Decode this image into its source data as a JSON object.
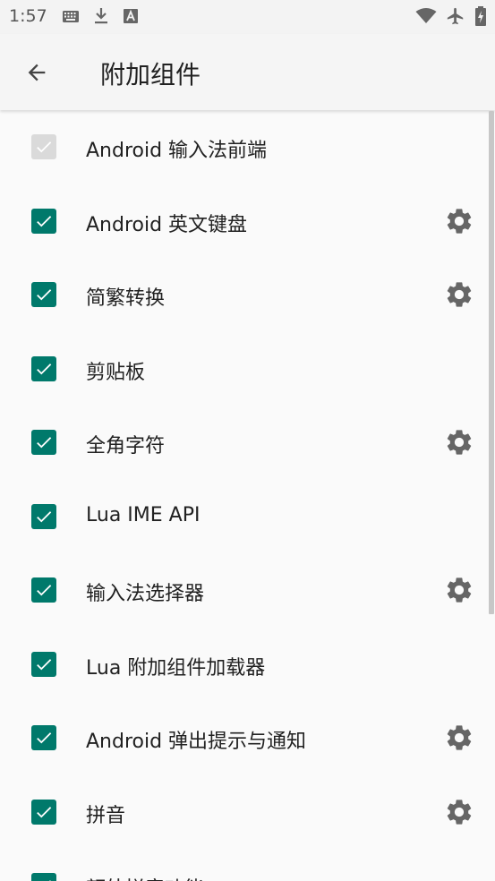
{
  "status_bar": {
    "time": "1:57",
    "left_icons": [
      "keyboard-icon",
      "download-icon",
      "font-a-icon"
    ],
    "right_icons": [
      "wifi-icon",
      "airplane-icon",
      "battery-charging-icon"
    ]
  },
  "app_bar": {
    "title": "附加组件",
    "back_icon": "arrow-back-icon"
  },
  "colors": {
    "accent": "#00796b",
    "disabled": "#dadada",
    "text": "#212121",
    "icon": "#666666"
  },
  "plugins": [
    {
      "label": "Android 输入法前端",
      "checked": true,
      "disabled": true,
      "has_settings": false
    },
    {
      "label": "Android 英文键盘",
      "checked": true,
      "disabled": false,
      "has_settings": true
    },
    {
      "label": "简繁转换",
      "checked": true,
      "disabled": false,
      "has_settings": true
    },
    {
      "label": "剪贴板",
      "checked": true,
      "disabled": false,
      "has_settings": false
    },
    {
      "label": "全角字符",
      "checked": true,
      "disabled": false,
      "has_settings": true
    },
    {
      "label": "Lua IME API",
      "checked": true,
      "disabled": false,
      "has_settings": false
    },
    {
      "label": "输入法选择器",
      "checked": true,
      "disabled": false,
      "has_settings": true
    },
    {
      "label": "Lua 附加组件加载器",
      "checked": true,
      "disabled": false,
      "has_settings": false
    },
    {
      "label": "Android 弹出提示与通知",
      "checked": true,
      "disabled": false,
      "has_settings": true
    },
    {
      "label": "拼音",
      "checked": true,
      "disabled": false,
      "has_settings": true
    },
    {
      "label": "额外拼音功能",
      "checked": true,
      "disabled": false,
      "has_settings": false
    }
  ]
}
